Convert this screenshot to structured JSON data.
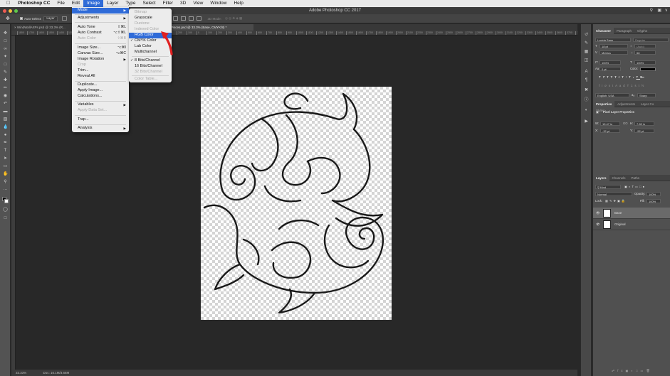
{
  "menubar": {
    "apple": "",
    "app_name": "Photoshop CC",
    "items": [
      "File",
      "Edit",
      "Image",
      "Layer",
      "Type",
      "Select",
      "Filter",
      "3D",
      "View",
      "Window",
      "Help"
    ],
    "active_item": "Image"
  },
  "titlebar": {
    "title": "Adobe Photoshop CC 2017"
  },
  "options": {
    "auto_select_label": "Auto-Select:",
    "auto_select_value": "Layer",
    "mode_3d_label": "3D Mode:"
  },
  "tabs": [
    {
      "label": "WindWallArtPs.psd @ 33.3% (R..."
    },
    {
      "label": "Pisces.psd @ 33.3% (Base, CMYK/8) *"
    }
  ],
  "ruler": {
    "ticks": [
      "1800",
      "1700",
      "1600",
      "1500",
      "1400",
      "1300",
      "1200",
      "1100",
      "1000",
      "900",
      "800",
      "700",
      "600",
      "500",
      "400",
      "300",
      "200",
      "100",
      "0",
      "100",
      "200",
      "300",
      "400",
      "500",
      "600",
      "700",
      "800",
      "900",
      "1000",
      "1100",
      "1200",
      "1300",
      "1400",
      "1500",
      "1600",
      "1700",
      "1800",
      "1900",
      "2000",
      "2100",
      "2200",
      "2300",
      "2400",
      "2500",
      "2600",
      "2700",
      "2800",
      "2900",
      "3000",
      "3100",
      "3200",
      "3300",
      "3400",
      "3500",
      "3600",
      "3700",
      "3800"
    ]
  },
  "image_menu": {
    "items": [
      {
        "label": "Mode",
        "submenu": true,
        "highlighted": true
      },
      {
        "label": "Adjustments",
        "submenu": true
      },
      {
        "label": "Auto Tone",
        "shortcut": "⇧⌘L"
      },
      {
        "label": "Auto Contrast",
        "shortcut": "⌥⇧⌘L"
      },
      {
        "label": "Auto Color",
        "shortcut": "⇧⌘B",
        "disabled": true
      },
      {
        "label": "Image Size...",
        "shortcut": "⌥⌘I"
      },
      {
        "label": "Canvas Size...",
        "shortcut": "⌥⌘C"
      },
      {
        "label": "Image Rotation",
        "submenu": true
      },
      {
        "label": "Crop",
        "disabled": true
      },
      {
        "label": "Trim..."
      },
      {
        "label": "Reveal All"
      },
      {
        "label": "Duplicate..."
      },
      {
        "label": "Apply Image..."
      },
      {
        "label": "Calculations..."
      },
      {
        "label": "Variables",
        "submenu": true
      },
      {
        "label": "Apply Data Set...",
        "disabled": true
      },
      {
        "label": "Trap..."
      },
      {
        "label": "Analysis",
        "submenu": true
      }
    ]
  },
  "mode_menu": {
    "items": [
      {
        "label": "Bitmap",
        "disabled": true
      },
      {
        "label": "Grayscale"
      },
      {
        "label": "Duotone",
        "disabled": true
      },
      {
        "label": "Indexed Color",
        "disabled": true
      },
      {
        "label": "RGB Color",
        "highlighted": true
      },
      {
        "label": "CMYK Color",
        "checked": true
      },
      {
        "label": "Lab Color"
      },
      {
        "label": "Multichannel"
      },
      {
        "label": "8 Bits/Channel",
        "checked": true
      },
      {
        "label": "16 Bits/Channel"
      },
      {
        "label": "32 Bits/Channel",
        "disabled": true
      },
      {
        "label": "Color Table...",
        "disabled": true
      }
    ]
  },
  "status": {
    "zoom": "33.33%",
    "doc": "Doc: 16.1M/3.66M"
  },
  "character_panel": {
    "tabs": [
      "Character",
      "Paragraph",
      "Glyphs"
    ],
    "font_family": "Lucida Sans",
    "font_style": "Regular",
    "font_size": "18 pt",
    "leading": "(Auto)",
    "kerning": "Metrics",
    "tracking": "68",
    "vertical_scale": "100%",
    "horizontal_scale": "100%",
    "baseline": "0 pt",
    "color_label": "Color:",
    "language": "English: USA",
    "antialias": "Sharp",
    "type_style_buttons": [
      "T",
      "T",
      "TT",
      "Tr",
      "T¹",
      "T₁",
      "T",
      "T"
    ],
    "opentype_buttons": [
      "fi",
      "ơ",
      "st",
      "A",
      "ad",
      "T",
      "1st",
      "½"
    ],
    "aa_label": "aₐ"
  },
  "properties_panel": {
    "tabs": [
      "Properties",
      "Adjustments",
      "Layer Co",
      "Styles"
    ],
    "title": "Pixel Layer Properties",
    "w_label": "W:",
    "w_value": "15.47 in",
    "h_label": "H:",
    "h_value": "7.83 in",
    "go_label": "GO",
    "x_label": "X:",
    "x_value": "-32 pt",
    "y_label": "Y:",
    "y_value": "-52 pt"
  },
  "layers_panel": {
    "tabs": [
      "Layers",
      "Channels",
      "Paths"
    ],
    "kind": "Kind",
    "blend_mode": "Normal",
    "opacity_label": "Opacity:",
    "opacity": "100%",
    "lock_label": "Lock:",
    "fill_label": "Fill:",
    "fill": "100%",
    "layers": [
      {
        "name": "Base",
        "selected": true
      },
      {
        "name": "Original",
        "selected": false
      }
    ]
  },
  "colors": {
    "menu_highlight": "#2f6bd8",
    "arrow": "#e02020"
  }
}
